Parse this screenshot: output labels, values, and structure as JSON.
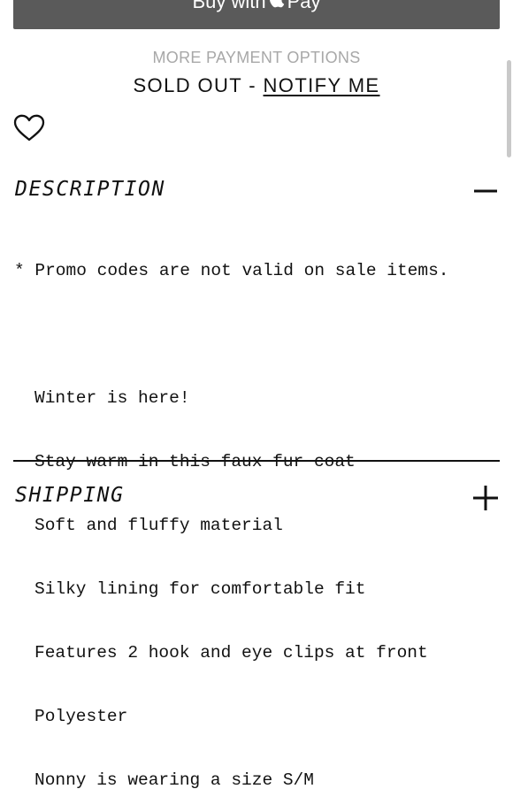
{
  "pay_button": {
    "label_prefix": "Buy with",
    "label_suffix": "Pay",
    "icon": "apple-logo-icon"
  },
  "more_payment_options": "MORE PAYMENT OPTIONS",
  "stock": {
    "status": "SOLD OUT",
    "separator": "-",
    "notify_label": "NOTIFY ME"
  },
  "wishlist": {
    "icon": "heart-icon"
  },
  "description": {
    "title": "DESCRIPTION",
    "toggle_icon": "minus-icon",
    "promo_note": "* Promo codes are not valid on sale items.",
    "lines": [
      "Winter is here!",
      "Stay warm in this faux fur coat",
      "Soft and fluffy material",
      "Silky lining for comfortable fit",
      "Features 2 hook and eye clips at front",
      "Polyester",
      "Nonny is wearing a size S/M"
    ]
  },
  "shipping": {
    "title": "SHIPPING",
    "toggle_icon": "plus-icon"
  },
  "colors": {
    "button_bg": "#5a5a5a",
    "muted_text": "#a8a8a8",
    "text": "#111111",
    "background": "#ffffff"
  }
}
